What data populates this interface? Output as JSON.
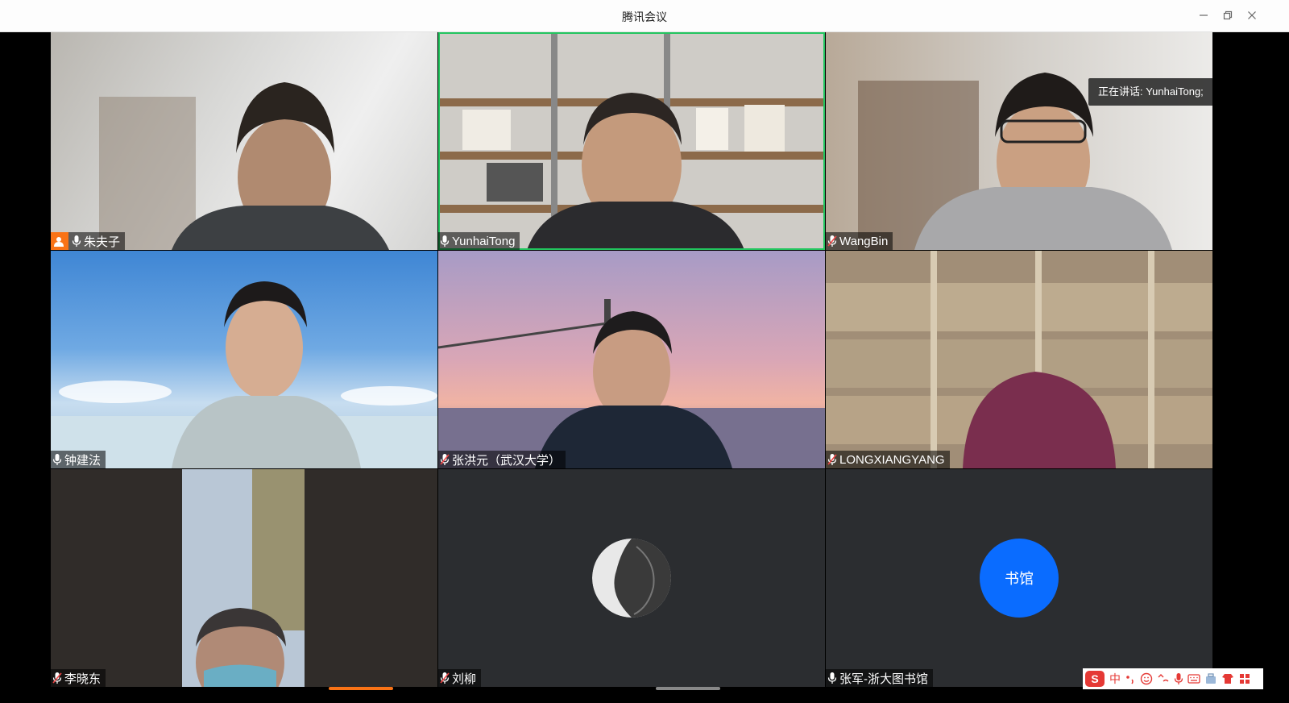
{
  "window": {
    "title": "腾讯会议"
  },
  "colors": {
    "active_border": "#22c55e",
    "host_badge": "#f97316",
    "avatar_blue": "#0a6cff",
    "ime_red": "#e53935"
  },
  "speaking_indicator": "正在讲话: YunhaiTong;",
  "participants": [
    {
      "name": "朱夫子",
      "mic": "on",
      "host": true,
      "active": false
    },
    {
      "name": "YunhaiTong",
      "mic": "on",
      "host": false,
      "active": true
    },
    {
      "name": "WangBin",
      "mic": "muted",
      "host": false,
      "active": false
    },
    {
      "name": "钟建法",
      "mic": "on",
      "host": false,
      "active": false
    },
    {
      "name": "张洪元（武汉大学）",
      "mic": "muted",
      "host": false,
      "active": false
    },
    {
      "name": "LONGXIANGYANG",
      "mic": "muted",
      "host": false,
      "active": false
    },
    {
      "name": "李晓东",
      "mic": "muted",
      "host": false,
      "active": false
    },
    {
      "name": "刘柳",
      "mic": "muted",
      "host": false,
      "active": false,
      "avatar": "photo"
    },
    {
      "name": "张军-浙大图书馆",
      "mic": "on",
      "host": false,
      "active": false,
      "avatar_text": "书馆"
    }
  ],
  "ime_toolbar": {
    "logo": "S",
    "mode": "中"
  }
}
